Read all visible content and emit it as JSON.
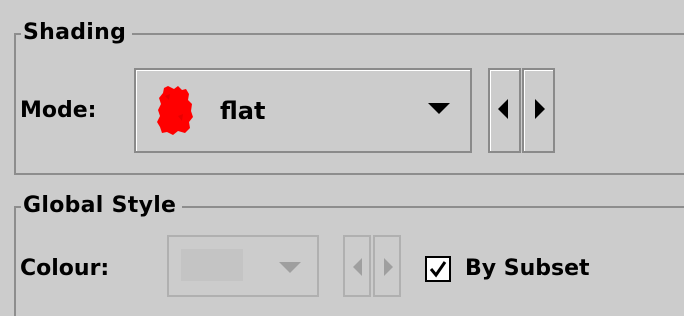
{
  "shading": {
    "title": "Shading",
    "mode_label": "Mode:",
    "mode_value": "flat",
    "mode_icon": "red-blob-icon",
    "mode_color": "#ff0000"
  },
  "global_style": {
    "title": "Global Style",
    "colour_label": "Colour:",
    "by_subset_label": "By Subset",
    "by_subset_checked": true
  }
}
